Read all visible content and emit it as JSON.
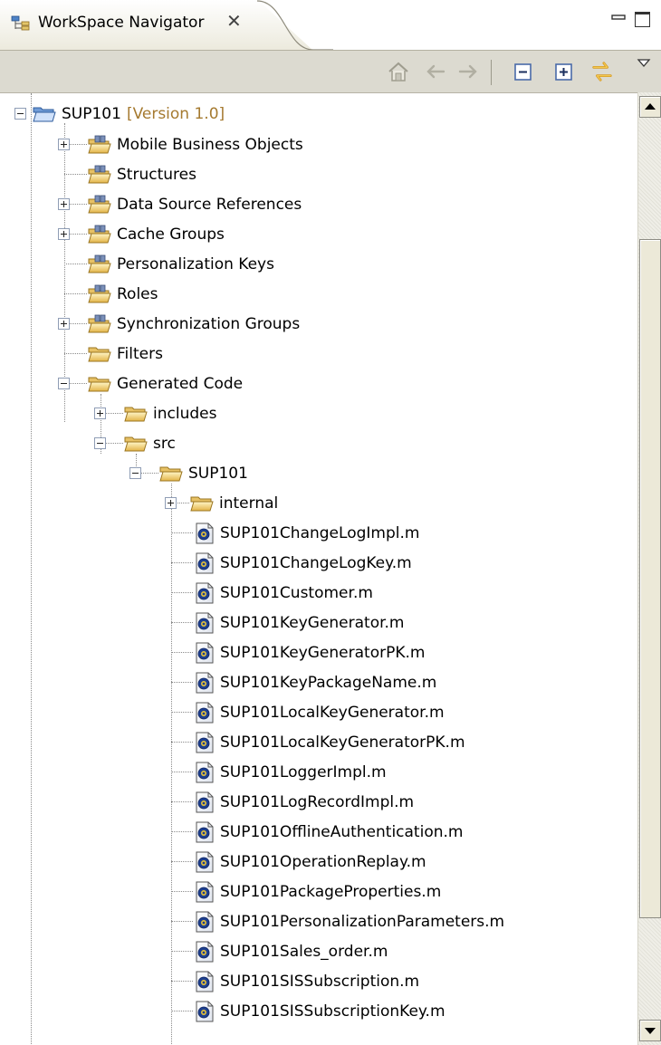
{
  "view": {
    "title": "WorkSpace Navigator",
    "close_symbol": "✕",
    "icons": {
      "tab": "navigator-icon",
      "minimize": "minimize-icon",
      "maximize": "maximize-icon",
      "menu": "view-menu-icon"
    }
  },
  "toolbar": {
    "buttons": [
      {
        "name": "home-icon"
      },
      {
        "name": "back-icon"
      },
      {
        "name": "forward-icon"
      },
      {
        "name": "collapse-all-icon"
      },
      {
        "name": "expand-all-icon"
      },
      {
        "name": "link-with-editor-icon"
      }
    ]
  },
  "tree": {
    "project": {
      "label": "SUP101",
      "version": "[Version 1.0]"
    },
    "folders": [
      {
        "label": "Mobile Business Objects"
      },
      {
        "label": "Structures"
      },
      {
        "label": "Data Source References"
      },
      {
        "label": "Cache Groups"
      },
      {
        "label": "Personalization Keys"
      },
      {
        "label": "Roles"
      },
      {
        "label": "Synchronization Groups"
      },
      {
        "label": "Filters"
      },
      {
        "label": "Generated Code"
      }
    ],
    "generated": {
      "includes": "includes",
      "src": "src",
      "package": "SUP101",
      "internal": "internal"
    },
    "files": [
      "SUP101ChangeLogImpl.m",
      "SUP101ChangeLogKey.m",
      "SUP101Customer.m",
      "SUP101KeyGenerator.m",
      "SUP101KeyGeneratorPK.m",
      "SUP101KeyPackageName.m",
      "SUP101LocalKeyGenerator.m",
      "SUP101LocalKeyGeneratorPK.m",
      "SUP101LoggerImpl.m",
      "SUP101LogRecordImpl.m",
      "SUP101OfflineAuthentication.m",
      "SUP101OperationReplay.m",
      "SUP101PackageProperties.m",
      "SUP101PersonalizationParameters.m",
      "SUP101Sales_order.m",
      "SUP101SISSubscription.m",
      "SUP101SISSubscriptionKey.m"
    ]
  },
  "colors": {
    "version": "#a57a30",
    "toolbar_bg": "#dcdad0",
    "accent": "#3c6ab0"
  }
}
